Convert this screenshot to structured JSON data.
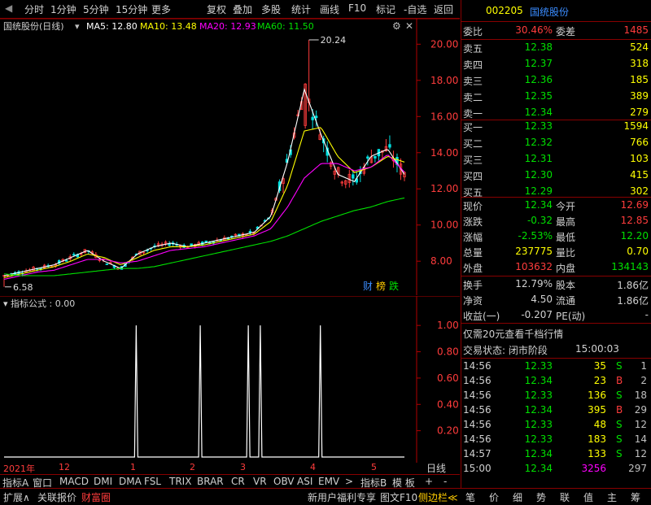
{
  "toolbar": {
    "items": [
      "分时",
      "1分钟",
      "5分钟",
      "15分钟",
      "更多",
      "复权",
      "叠加",
      "多股",
      "统计",
      "画线",
      "F10",
      "标记",
      "-自选",
      "返回"
    ]
  },
  "chart_header": {
    "stock_name": "国统股份(日线)",
    "ma5": "MA5: 12.80",
    "ma10": "MA10: 13.48",
    "ma20": "MA20: 12.93",
    "ma60": "MA60: 11.50",
    "high_label": "20.24",
    "low_label": "6.58",
    "badges": [
      "财",
      "榜",
      "跌"
    ]
  },
  "indicator_header": {
    "name": "指标公式 : 0.00"
  },
  "colors": {
    "up": "#ff3c3c",
    "down": "#00e0e0",
    "ma5": "#ffffff",
    "ma10": "#ffff00",
    "ma20": "#ff00ff",
    "ma60": "#00e000",
    "axis": "#b00000"
  },
  "chart_data": [
    {
      "type": "line",
      "title": "国统股份(日线)",
      "y_ticks": [
        8.0,
        10.0,
        12.0,
        14.0,
        16.0,
        18.0,
        20.0
      ],
      "ylim": [
        6.3,
        20.6
      ],
      "x_ticks": [
        "2021年",
        "12",
        "1",
        "2",
        "3",
        "4",
        "5"
      ],
      "series": [
        {
          "name": "MA5",
          "values": [
            7.2,
            7.4,
            7.6,
            7.8,
            8.2,
            8.6,
            8.0,
            7.6,
            8.4,
            8.8,
            9.0,
            8.8,
            9.0,
            9.2,
            9.4,
            9.6,
            10.5,
            13.5,
            17.5,
            15.0,
            12.8,
            12.4,
            13.8,
            14.2,
            12.8
          ]
        },
        {
          "name": "MA10",
          "values": [
            7.1,
            7.3,
            7.5,
            7.7,
            8.0,
            8.4,
            8.2,
            7.8,
            8.2,
            8.6,
            8.8,
            8.8,
            8.9,
            9.1,
            9.3,
            9.5,
            10.2,
            12.2,
            15.2,
            15.4,
            13.8,
            12.9,
            13.2,
            13.8,
            13.48
          ]
        },
        {
          "name": "MA20",
          "values": [
            7.0,
            7.2,
            7.4,
            7.5,
            7.8,
            8.1,
            8.1,
            7.9,
            8.0,
            8.3,
            8.6,
            8.7,
            8.8,
            9.0,
            9.2,
            9.4,
            9.8,
            11.0,
            12.6,
            13.4,
            13.4,
            13.0,
            13.2,
            13.9,
            12.93
          ]
        },
        {
          "name": "MA60",
          "values": [
            7.3,
            7.2,
            7.2,
            7.2,
            7.3,
            7.4,
            7.5,
            7.6,
            7.6,
            7.7,
            7.9,
            8.1,
            8.3,
            8.5,
            8.7,
            8.9,
            9.1,
            9.4,
            9.8,
            10.2,
            10.5,
            10.8,
            11.0,
            11.3,
            11.5
          ]
        }
      ]
    },
    {
      "type": "line",
      "title": "指标公式",
      "y_ticks": [
        0.2,
        0.4,
        0.6,
        0.8,
        1.0
      ],
      "ylim": [
        0,
        1.1
      ],
      "spikes_at_fraction": [
        0.33,
        0.49,
        0.61,
        0.64,
        0.79
      ]
    }
  ],
  "date_axis": [
    "2021年",
    "12",
    "1",
    "2",
    "3",
    "4",
    "5"
  ],
  "indicator_tabs": [
    "指标A",
    "窗口",
    "MACD",
    "DMI",
    "DMA",
    "FSL",
    "TRIX",
    "BRAR",
    "CR",
    "VR",
    "OBV",
    "ASI",
    "EMV",
    ">",
    "指标B",
    "模 板",
    "+",
    "-"
  ],
  "period_label": "日线",
  "status_left": [
    "扩展∧",
    "关联报价",
    "财富圈"
  ],
  "status_mid": [
    "新用户福利专享",
    "图文F10",
    "侧边栏≪"
  ],
  "status_right": [
    "笔",
    "价",
    "细",
    "势",
    "联",
    "值",
    "主",
    "筹"
  ],
  "panel": {
    "code": "002205",
    "name": "国统股份",
    "weibi_label": "委比",
    "weibi_value": "30.46%",
    "weicha_label": "委差",
    "weicha_value": "1485",
    "asks": [
      {
        "label": "卖五",
        "price": "12.38",
        "vol": "524"
      },
      {
        "label": "卖四",
        "price": "12.37",
        "vol": "318"
      },
      {
        "label": "卖三",
        "price": "12.36",
        "vol": "185"
      },
      {
        "label": "卖二",
        "price": "12.35",
        "vol": "389"
      },
      {
        "label": "卖一",
        "price": "12.34",
        "vol": "279"
      }
    ],
    "bids": [
      {
        "label": "买一",
        "price": "12.33",
        "vol": "1594"
      },
      {
        "label": "买二",
        "price": "12.32",
        "vol": "766"
      },
      {
        "label": "买三",
        "price": "12.31",
        "vol": "103"
      },
      {
        "label": "买四",
        "price": "12.30",
        "vol": "415"
      },
      {
        "label": "买五",
        "price": "12.29",
        "vol": "302"
      }
    ],
    "stats": [
      {
        "l1": "现价",
        "v1": "12.34",
        "c1": "green",
        "l2": "今开",
        "v2": "12.69",
        "c2": "red"
      },
      {
        "l1": "涨跌",
        "v1": "-0.32",
        "c1": "green",
        "l2": "最高",
        "v2": "12.85",
        "c2": "red"
      },
      {
        "l1": "涨幅",
        "v1": "-2.53%",
        "c1": "green",
        "l2": "最低",
        "v2": "12.20",
        "c2": "green"
      },
      {
        "l1": "总量",
        "v1": "237775",
        "c1": "yellow",
        "l2": "量比",
        "v2": "0.70",
        "c2": "yellow"
      },
      {
        "l1": "外盘",
        "v1": "103632",
        "c1": "red",
        "l2": "内盘",
        "v2": "134143",
        "c2": "green"
      }
    ],
    "stats2": [
      {
        "l1": "换手",
        "v1": "12.79%",
        "l2": "股本",
        "v2": "1.86亿"
      },
      {
        "l1": "净资",
        "v1": "4.50",
        "l2": "流通",
        "v2": "1.86亿"
      },
      {
        "l1": "收益(一)",
        "v1": "-0.207",
        "l2": "PE(动)",
        "v2": "-"
      }
    ],
    "promo": "仅需20元查看千档行情",
    "trade_status": "交易状态: 闭市阶段",
    "trade_time": "15:00:03",
    "ticks": [
      {
        "t": "14:56",
        "p": "12.33",
        "v": "35",
        "bs": "S",
        "n": "1"
      },
      {
        "t": "14:56",
        "p": "12.34",
        "v": "23",
        "bs": "B",
        "n": "2"
      },
      {
        "t": "14:56",
        "p": "12.33",
        "v": "136",
        "bs": "S",
        "n": "18"
      },
      {
        "t": "14:56",
        "p": "12.34",
        "v": "395",
        "bs": "B",
        "n": "29"
      },
      {
        "t": "14:56",
        "p": "12.33",
        "v": "48",
        "bs": "S",
        "n": "12"
      },
      {
        "t": "14:56",
        "p": "12.33",
        "v": "183",
        "bs": "S",
        "n": "14"
      },
      {
        "t": "14:57",
        "p": "12.34",
        "v": "133",
        "bs": "S",
        "n": "12"
      },
      {
        "t": "15:00",
        "p": "12.34",
        "v": "3256",
        "bs": "",
        "n": "297"
      }
    ]
  }
}
